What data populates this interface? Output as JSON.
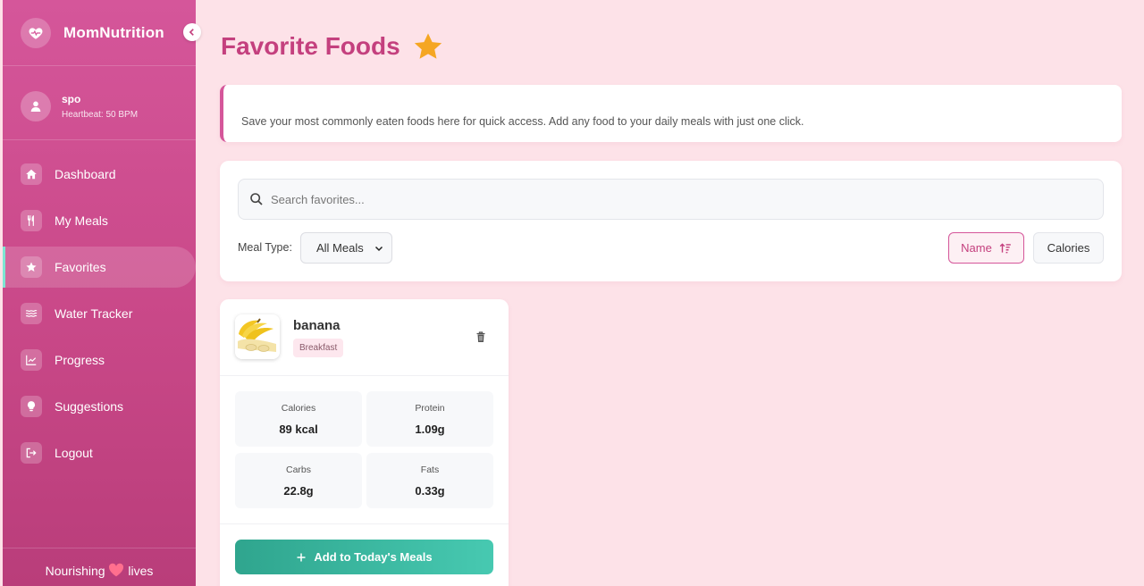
{
  "sidebar": {
    "brand": "MomNutrition",
    "user": {
      "name": "spo",
      "heartbeat": "Heartbeat: 50 BPM"
    },
    "items": [
      {
        "label": "Dashboard",
        "icon": "home-icon"
      },
      {
        "label": "My Meals",
        "icon": "utensils-icon"
      },
      {
        "label": "Favorites",
        "icon": "star-icon",
        "active": true
      },
      {
        "label": "Water Tracker",
        "icon": "water-icon"
      },
      {
        "label": "Progress",
        "icon": "chart-line-icon"
      },
      {
        "label": "Suggestions",
        "icon": "lightbulb-icon"
      },
      {
        "label": "Logout",
        "icon": "logout-icon"
      }
    ],
    "footer": {
      "left": "Nourishing",
      "right": "lives"
    }
  },
  "page": {
    "title": "Favorite Foods",
    "info": "Save your most commonly eaten foods here for quick access. Add any food to your daily meals with just one click."
  },
  "filters": {
    "search_placeholder": "Search favorites...",
    "meal_type_label": "Meal Type:",
    "meal_type_value": "All Meals",
    "sort_name_label": "Name",
    "sort_calories_label": "Calories"
  },
  "foods": [
    {
      "name": "banana",
      "meal": "Breakfast",
      "stats": {
        "calories_label": "Calories",
        "calories": "89 kcal",
        "protein_label": "Protein",
        "protein": "1.09g",
        "carbs_label": "Carbs",
        "carbs": "22.8g",
        "fats_label": "Fats",
        "fats": "0.33g"
      },
      "add_label": "Add to Today's Meals"
    }
  ],
  "colors": {
    "accent": "#d5569a",
    "title": "#c4407e",
    "background": "#fde2e8",
    "add_button": "#2fa58e",
    "active_marker": "#7ee6d2",
    "favorite_star": "#f5a623"
  }
}
